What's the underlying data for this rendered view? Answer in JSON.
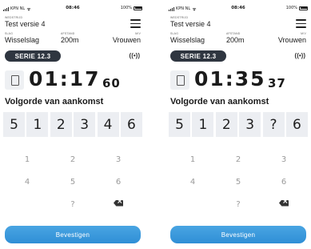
{
  "status_bar": {
    "carrier": "KPN NL",
    "time": "08:46",
    "battery": "100%"
  },
  "screens": [
    {
      "wedstrijd_label": "WEDSTRIJD",
      "wedstrijd_name": "Test versie 4",
      "slag_label": "SLAG",
      "slag_value": "Wisselslag",
      "afstand_label": "AFSTAND",
      "afstand_value": "200m",
      "mv_label": "M/V",
      "mv_value": "Vrouwen",
      "serie": "SERIE 12.3",
      "signal_symbol": "((•))",
      "timer_main": "01:17",
      "timer_hundredths": "60",
      "volgorde_title": "Volgorde van aankomst",
      "order": [
        "5",
        "1",
        "2",
        "3",
        "4",
        "6"
      ],
      "keypad": [
        [
          "1",
          "2",
          "3"
        ],
        [
          "4",
          "5",
          "6"
        ],
        [
          "",
          "?",
          "backspace"
        ]
      ],
      "confirm_label": "Bevestigen"
    },
    {
      "wedstrijd_label": "WEDSTRIJD",
      "wedstrijd_name": "Test versie 4",
      "slag_label": "SLAG",
      "slag_value": "Wisselslag",
      "afstand_label": "AFSTAND",
      "afstand_value": "200m",
      "mv_label": "M/V",
      "mv_value": "Vrouwen",
      "serie": "SERIE 12.3",
      "signal_symbol": "((•))",
      "timer_main": "01:35",
      "timer_hundredths": "37",
      "volgorde_title": "Volgorde van aankomst",
      "order": [
        "5",
        "1",
        "2",
        "3",
        "?",
        "6"
      ],
      "keypad": [
        [
          "1",
          "2",
          "3"
        ],
        [
          "4",
          "5",
          "6"
        ],
        [
          "",
          "?",
          "backspace"
        ]
      ],
      "confirm_label": "Bevestigen"
    }
  ],
  "colors": {
    "pill": "#2f3640",
    "button": "#3b9ad9",
    "cell": "#eceef2",
    "key_text": "#9a9a9a"
  }
}
